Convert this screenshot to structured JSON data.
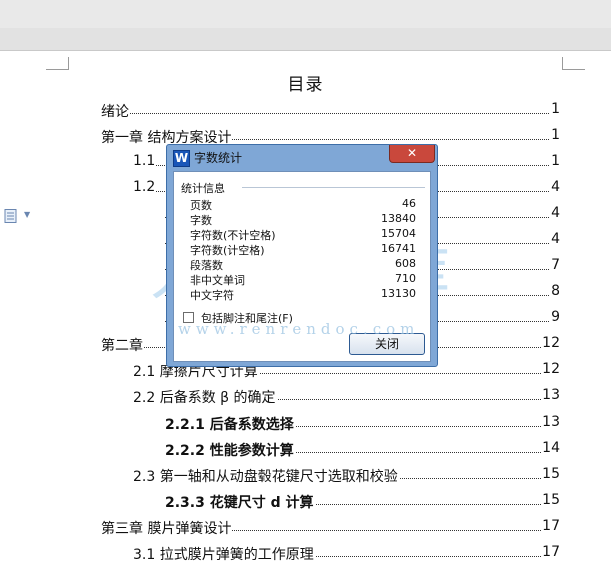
{
  "document": {
    "toc_title": "目录",
    "toc": [
      {
        "text": "绪论",
        "page": "1",
        "indent": 0,
        "bold": false
      },
      {
        "text": "第一章      结构方案设计",
        "page": "1",
        "indent": 0,
        "bold": false
      },
      {
        "text": "1.1",
        "page": "1",
        "indent": 1,
        "bold": false
      },
      {
        "text": "1.2",
        "page": "4",
        "indent": 1,
        "bold": false
      },
      {
        "text": "",
        "page": "4",
        "indent": 2,
        "bold": false
      },
      {
        "text": "",
        "page": "4",
        "indent": 2,
        "bold": false
      },
      {
        "text": "",
        "page": "7",
        "indent": 2,
        "bold": false
      },
      {
        "text": "",
        "page": "8",
        "indent": 2,
        "bold": false
      },
      {
        "text": "",
        "page": "9",
        "indent": 2,
        "bold": false
      },
      {
        "text": "第二章",
        "page": "12",
        "indent": 0,
        "bold": false
      },
      {
        "text": "2.1  摩擦片尺寸计算",
        "page": "12",
        "indent": 1,
        "bold": false
      },
      {
        "text": "2.2  后备系数 β 的确定",
        "page": "13",
        "indent": 1,
        "bold": false
      },
      {
        "text": "2.2.1 后备系数选择",
        "page": "13",
        "indent": 2,
        "bold": true
      },
      {
        "text": "2.2.2  性能参数计算",
        "page": "14",
        "indent": 2,
        "bold": true
      },
      {
        "text": "2.3    第一轴和从动盘毂花键尺寸选取和校验",
        "page": "15",
        "indent": 1,
        "bold": false
      },
      {
        "text": "2.3.3  花键尺寸 d 计算",
        "page": "15",
        "indent": 2,
        "bold": true
      },
      {
        "text": "第三章      膜片弹簧设计",
        "page": "17",
        "indent": 0,
        "bold": false
      },
      {
        "text": "3.1  拉式膜片弹簧的工作原理",
        "page": "17",
        "indent": 1,
        "bold": false
      }
    ]
  },
  "dialog": {
    "title": "字数统计",
    "close_label": "✕",
    "group_title": "统计信息",
    "stats": [
      {
        "label": "页数",
        "value": "46"
      },
      {
        "label": "字数",
        "value": "13840"
      },
      {
        "label": "字符数(不计空格)",
        "value": "15704"
      },
      {
        "label": "字符数(计空格)",
        "value": "16741"
      },
      {
        "label": "段落数",
        "value": "608"
      },
      {
        "label": "非中文单词",
        "value": "710"
      },
      {
        "label": "中文字符",
        "value": "13130"
      }
    ],
    "checkbox_label": "包括脚注和尾注(F)",
    "checkbox_checked": false,
    "ok_label": "关闭"
  },
  "watermark": {
    "text": "www.renrendoc.com",
    "chars": [
      "人",
      "人",
      "文",
      "库"
    ]
  },
  "colors": {
    "dialog_frame": "#7fa7d6",
    "close_button": "#c9483c",
    "app_logo": "#1a56b8"
  }
}
